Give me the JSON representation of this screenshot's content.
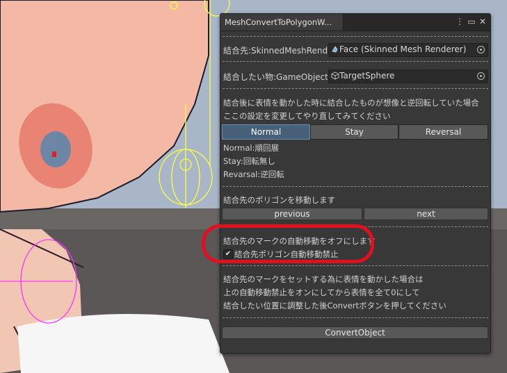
{
  "window": {
    "tab_title": "MeshConvertToPolygonW...",
    "controls": {
      "menu": "⋮",
      "maximize": "▭",
      "close": "✕"
    }
  },
  "fields": {
    "target_label": "結合先:SkinnedMeshRende",
    "target_value": "Face (Skinned Mesh Renderer)",
    "source_label": "結合したい物:GameObject",
    "source_value": "TargetSphere"
  },
  "rotation": {
    "desc_line1": "結合後に表情を動かした時に結合したものが想像と逆回転していた場合",
    "desc_line2": "ここの設定を変更してやり直してみてください",
    "options": [
      "Normal",
      "Stay",
      "Reversal"
    ],
    "selected": "Normal",
    "help1": "Normal:順回展",
    "help2": "Stay:回転無し",
    "help3": "Revarsal:逆回転"
  },
  "move": {
    "label": "結合先のポリゴンを移動します",
    "previous": "previous",
    "next": "next"
  },
  "auto_move": {
    "label": "結合先のマークの自動移動をオフにします",
    "checkbox_label": "結合先ポリゴン自動移動禁止",
    "checked": true,
    "check_glyph": "✔"
  },
  "instructions": {
    "line1": "結合先のマークをセットする為に表情を動かした場合は",
    "line2": "上の自動移動禁止をオンにしてから表情を全て0にして",
    "line3": "結合したい位置に調整した後Convertボタンを押してください"
  },
  "convert": {
    "label": "ConvertObject"
  },
  "colors": {
    "highlight": "#e01020",
    "gizmo": "#ffff40",
    "selected_toggle": "#46607c"
  }
}
